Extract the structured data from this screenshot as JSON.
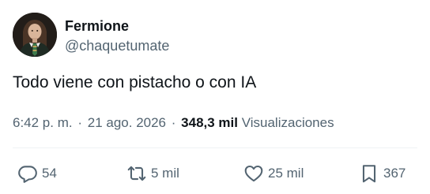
{
  "author": {
    "display_name": "Fermione",
    "handle": "@chaquetumate"
  },
  "tweet": {
    "text": "Todo viene con pistacho o con IA"
  },
  "meta": {
    "time": "6:42 p. m.",
    "separator": "·",
    "date": "21 ago. 2026",
    "views_count": "348,3 mil",
    "views_label": "Visualizaciones"
  },
  "actions": {
    "replies": "54",
    "retweets": "5 mil",
    "likes": "25 mil",
    "bookmarks": "367"
  },
  "colors": {
    "text_primary": "#0f1419",
    "text_secondary": "#536471",
    "divider": "#eff3f4"
  },
  "icons": {
    "reply": "speech-bubble-icon",
    "retweet": "retweet-arrows-icon",
    "like": "heart-icon",
    "bookmark": "bookmark-icon"
  }
}
